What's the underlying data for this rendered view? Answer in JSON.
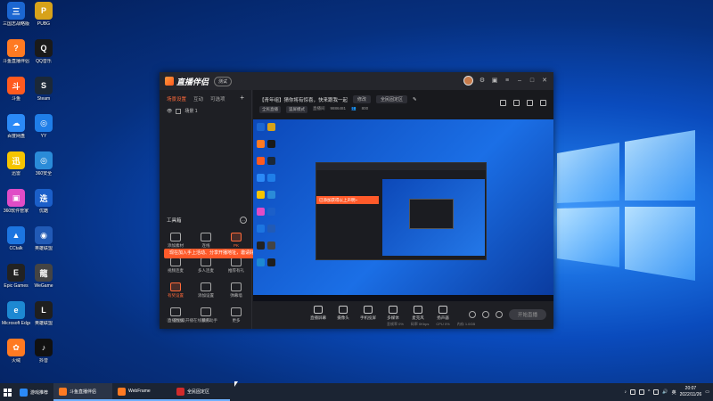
{
  "desktop": {
    "icons": [
      {
        "label": "三国志战略版",
        "color": "#1b66d1",
        "glyph": "三"
      },
      {
        "label": "PUBG",
        "color": "#d7a21a",
        "glyph": "P"
      },
      {
        "label": "斗鱼直播伴侣",
        "color": "#ff7a22",
        "glyph": "?"
      },
      {
        "label": "QQ音乐",
        "color": "#1a1a1a",
        "glyph": "Q"
      },
      {
        "label": "斗鱼",
        "color": "#ff5a1f",
        "glyph": "斗"
      },
      {
        "label": "Steam",
        "color": "#1b2838",
        "glyph": "S"
      },
      {
        "label": "百度网盘",
        "color": "#2b8af7",
        "glyph": "☁"
      },
      {
        "label": "YY",
        "color": "#1f7ee8",
        "glyph": "◎"
      },
      {
        "label": "迅雷",
        "color": "#f5c400",
        "glyph": "迅"
      },
      {
        "label": "360安全",
        "color": "#2a8bd8",
        "glyph": "◎"
      },
      {
        "label": "360软件管家",
        "color": "#e04cc6",
        "glyph": "▣"
      },
      {
        "label": "优酷",
        "color": "#1b5fc9",
        "glyph": "迭"
      },
      {
        "label": "CCtalk",
        "color": "#1c75e0",
        "glyph": "▲"
      },
      {
        "label": "英雄联盟",
        "color": "#215ab6",
        "glyph": "◉"
      },
      {
        "label": "Epic Games",
        "color": "#222222",
        "glyph": "E"
      },
      {
        "label": "WeGame",
        "color": "#444444",
        "glyph": "龍"
      },
      {
        "label": "Microsoft Edge",
        "color": "#1d88d2",
        "glyph": "e"
      },
      {
        "label": "英雄联盟",
        "color": "#1f1f1f",
        "glyph": "L"
      },
      {
        "label": "火绒",
        "color": "#ff7a22",
        "glyph": "✿"
      },
      {
        "label": "抖音",
        "color": "#111111",
        "glyph": "♪"
      }
    ]
  },
  "app": {
    "title": "直播伴侣",
    "version": "测试",
    "tabs": [
      "场景设置",
      "互动",
      "可选项"
    ],
    "scene_label": "场景 1",
    "toolbox_label": "工具箱",
    "tools": [
      {
        "label": "添加素材",
        "orange": false
      },
      {
        "label": "连线",
        "orange": false
      },
      {
        "label": "PK",
        "orange": true
      },
      {
        "label": "视频连麦",
        "orange": false
      },
      {
        "label": "多人连麦",
        "orange": false
      },
      {
        "label": "推荐有礼",
        "orange": false
      },
      {
        "label": "有奖设置",
        "orange": true
      },
      {
        "label": "添加设置",
        "orange": false
      },
      {
        "label": "弹幕墙",
        "orange": false
      },
      {
        "label": "直播数据",
        "orange": false
      },
      {
        "label": "精彩",
        "orange": false
      },
      {
        "label": "更多",
        "orange": false
      }
    ],
    "tip_text": "现在加入手上活动、分享开播地址，邀请好友给你观看",
    "tip_close": "✕",
    "footer_text": "企业级开播在线服务助手",
    "stream": {
      "title": "【青年组】猜你将有惊喜，快来跟我一起",
      "edit_chip": "修改",
      "category_chip": "全民固定区",
      "tags": [
        "全民直播",
        "竖屏模式"
      ],
      "room_label": "直播间",
      "room_id": "9886481",
      "viewers": "800"
    },
    "nested_tip": "已添加获得以上声明~",
    "bottom_tools": [
      "直播屏幕",
      "摄像头",
      "手机投屏",
      "多媒体",
      "麦克风",
      "扬声器"
    ],
    "start_button": "开始直播",
    "status": [
      "丢帧率 0%",
      "码率 0Kbps",
      "CPU 0%",
      "内存 1.0GB"
    ]
  },
  "taskbar": {
    "items": [
      {
        "label": "游戏推荐",
        "color": "#2b8af7"
      },
      {
        "label": "斗鱼直播伴侣",
        "color": "#ff7a22"
      },
      {
        "label": "WebFrame",
        "color": "#ff7a22"
      },
      {
        "label": "全民固定区",
        "color": "#d12b2b"
      }
    ],
    "time": "20:07",
    "date": "2022/11/26",
    "input_method": "英"
  }
}
